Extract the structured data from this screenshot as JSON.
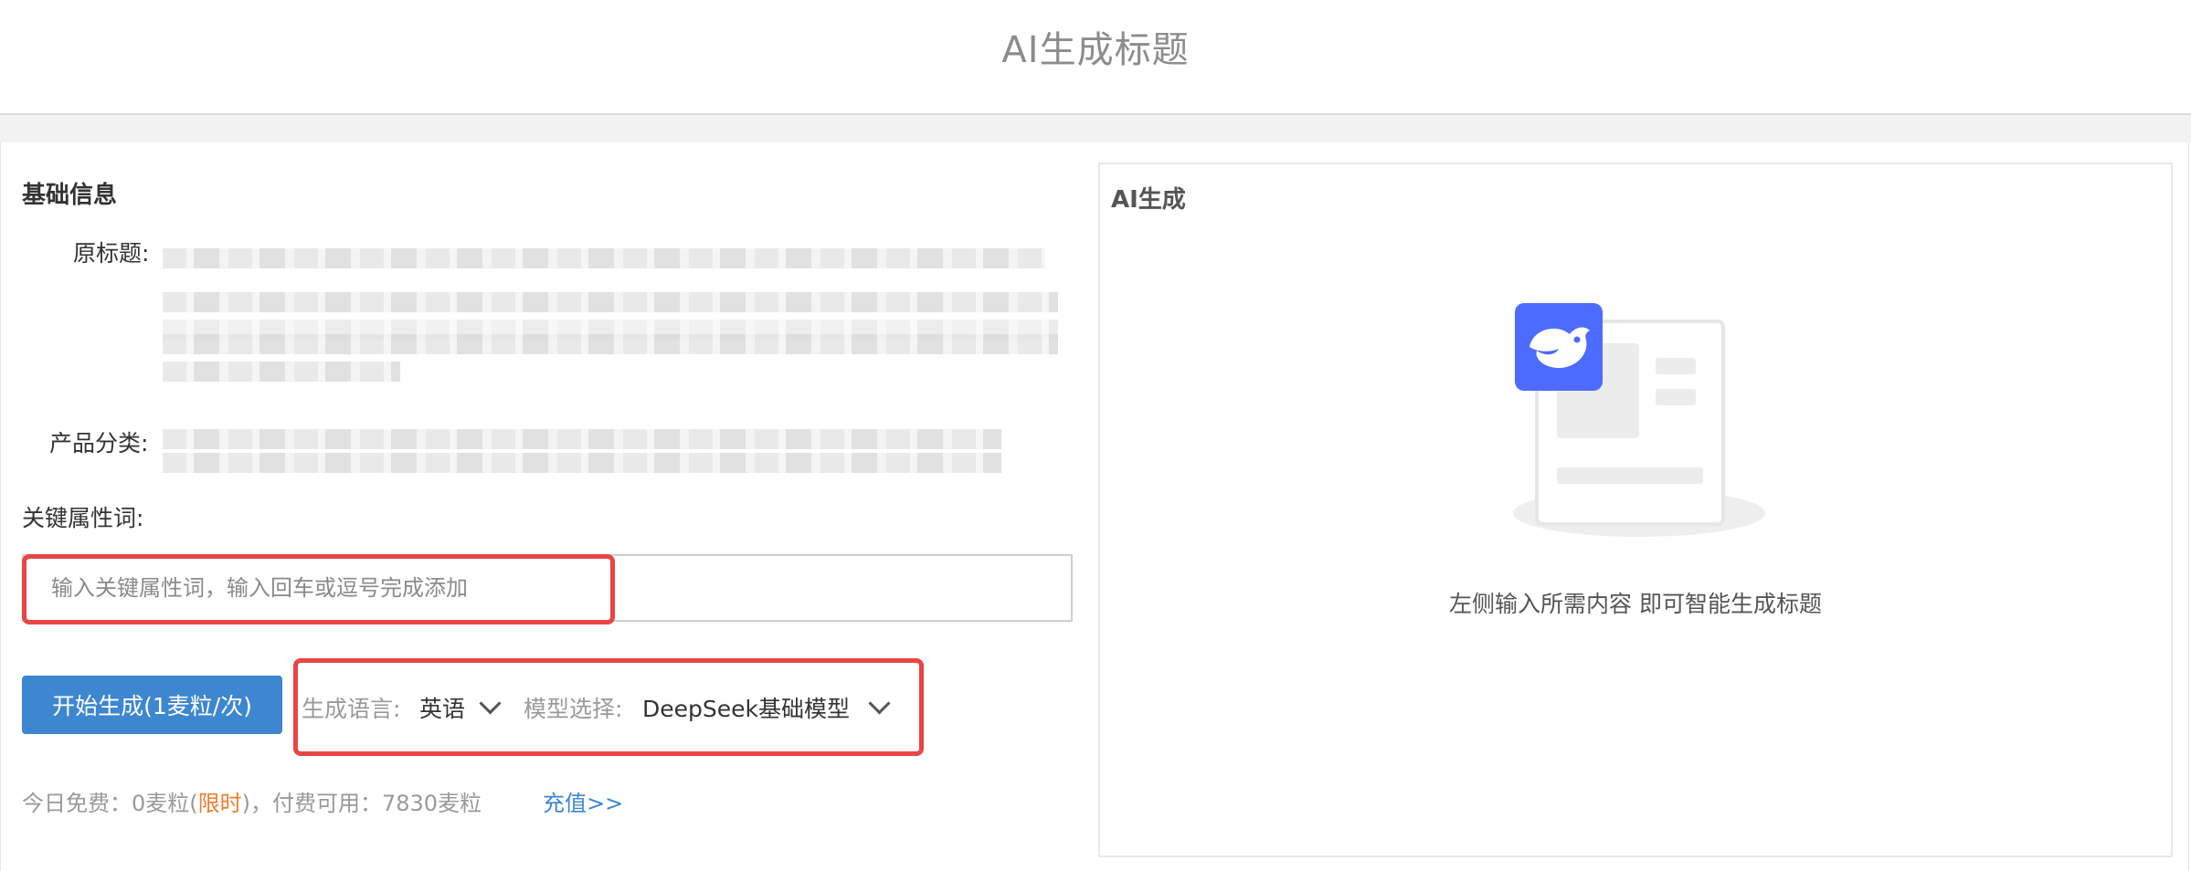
{
  "header": {
    "title": "AI生成标题"
  },
  "left": {
    "section_title": "基础信息",
    "original_title_label": "原标题:",
    "category_label": "产品分类:",
    "keywords_label": "关键属性词:",
    "keywords_input": {
      "placeholder": "输入关键属性词，输入回车或逗号完成添加",
      "value": ""
    },
    "generate_button": "开始生成(1麦粒/次)",
    "language": {
      "label": "生成语言:",
      "value": "英语"
    },
    "model": {
      "label": "模型选择:",
      "value": "DeepSeek基础模型"
    },
    "quota": {
      "prefix": "今日免费：0麦粒(",
      "limited": "限时",
      "suffix": ")，付费可用：7830麦粒",
      "recharge": "充值>>"
    }
  },
  "right": {
    "section_title": "AI生成",
    "hint": "左侧输入所需内容 即可智能生成标题",
    "icon": "deepseek-whale-icon"
  },
  "colors": {
    "primary": "#3d86d0",
    "highlight_box": "#e84545",
    "limited_text": "#f07c2e",
    "deepseek_blue": "#4d6bfe"
  }
}
